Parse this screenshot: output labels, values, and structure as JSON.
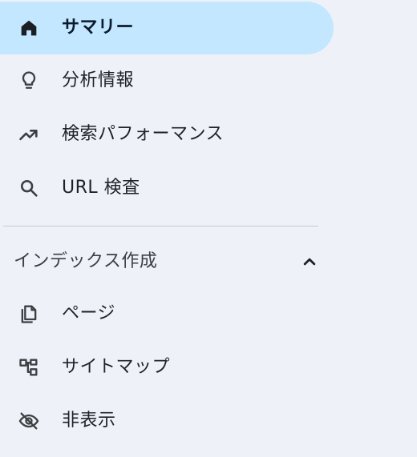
{
  "nav": {
    "items": [
      {
        "label": "サマリー",
        "icon": "home-icon",
        "active": true
      },
      {
        "label": "分析情報",
        "icon": "lightbulb-icon",
        "active": false
      },
      {
        "label": "検索パフォーマンス",
        "icon": "trending-up-icon",
        "active": false
      },
      {
        "label": "URL 検査",
        "icon": "search-icon",
        "active": false
      }
    ]
  },
  "index_section": {
    "title": "インデックス作成",
    "expanded": true,
    "items": [
      {
        "label": "ページ",
        "icon": "pages-icon"
      },
      {
        "label": "サイトマップ",
        "icon": "sitemap-icon"
      },
      {
        "label": "非表示",
        "icon": "visibility-off-icon"
      }
    ]
  },
  "colors": {
    "background": "#eef2f8",
    "active_background": "#c3e7ff",
    "divider": "#c7c9cc",
    "text": "#1f2328"
  }
}
